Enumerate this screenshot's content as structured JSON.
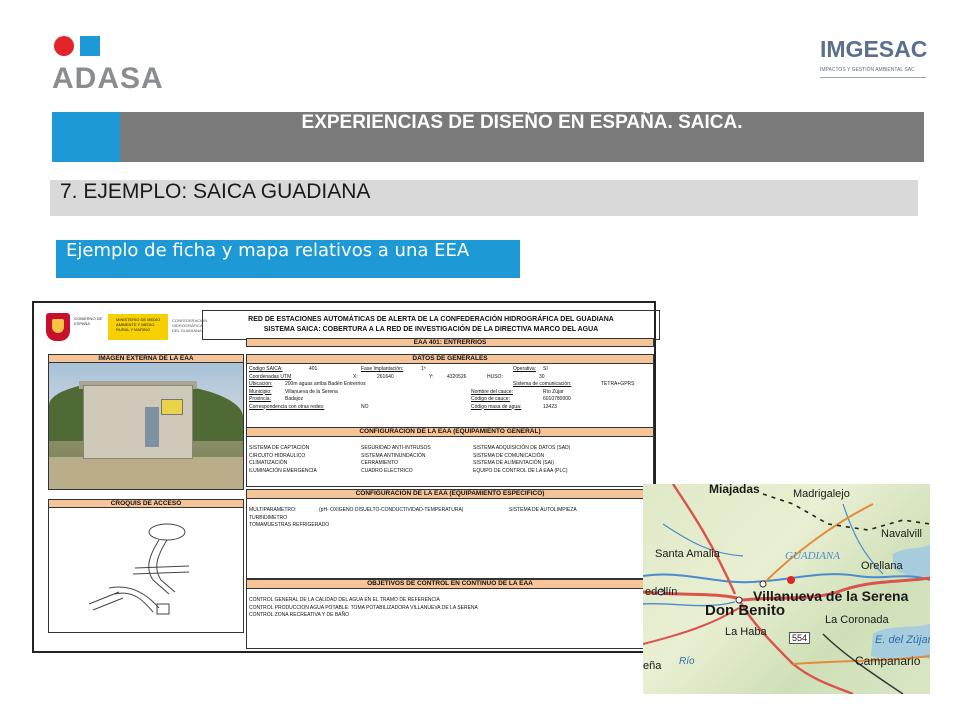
{
  "logos": {
    "left": "ADASA",
    "right": "IMGESAC",
    "right_tagline": "IMPACTOS Y GESTIÓN AMBIENTAL SAC",
    "brand_colors": {
      "red": "#e0242a",
      "blue": "#1d9ad6",
      "grey": "#8a8d8f"
    }
  },
  "header": {
    "title": "EXPERIENCIAS DE DISEÑO EN ESPAÑA. SAICA.",
    "section": "7. EJEMPLO: SAICA GUADIANA",
    "caption": "Ejemplo de ficha y mapa relativos a una EEA"
  },
  "sheet": {
    "gobierno": "GOBIERNO DE ESPAÑA",
    "ministerio": "MINISTERIO DE MEDIO AMBIENTE Y MEDIO RURAL Y MARINO",
    "confederacion": "CONFEDERACIÓN HIDROGRÁFICA DEL GUADIANA",
    "title_line1": "RED DE ESTACIONES AUTOMÁTICAS DE ALERTA DE LA CONFEDERACIÓN HIDROGRÁFICA DEL GUADIANA",
    "title_line2": "SISTEMA SAICA: COBERTURA A LA RED DE INVESTIGACIÓN DE LA DIRECTIVA MARCO DEL AGUA",
    "station": "EAA 401: ENTRERRIOS",
    "imagen_externa": "IMAGEN EXTERNA DE LA EAA",
    "croquis": "CROQUIS DE ACCESO",
    "datos": {
      "heading": "DATOS DE GENERALES",
      "codigo_label": "Codigo SAICA:",
      "codigo": "401",
      "fase_label": "Fase Implantación:",
      "fase": "1ª",
      "operativa_label": "Operativa:",
      "operativa": "SI",
      "utm_label": "Coordenadas UTM",
      "x_label": "X:",
      "x": "261640",
      "y_label": "Y:",
      "y": "4320526",
      "huso_label": "HUSO:",
      "huso": "30",
      "ubicacion_label": "Ubicación:",
      "ubicacion": "200m aguas arriba Badén Entrerrios",
      "comunicacion_label": "Sistema de comunicación:",
      "comunicacion": "TETRA+GPRS",
      "municipio_label": "Municipio:",
      "municipio": "Villanueva de la Serena",
      "cauce_label": "Nombre del cauce:",
      "cauce": "Río Zújar",
      "provincia_label": "Provincia:",
      "provincia": "Badajoz",
      "codcauce_label": "Codigo de cauce:",
      "codcauce": "6010780000",
      "redes_label": "Correspondencia con otras redes:",
      "redes": "NO",
      "masa_label": "Código masa de agua:",
      "masa": "13423"
    },
    "config_general": {
      "heading": "CONFIGURACIÓN DE LA EAA (EQUIPAMIENTO GENERAL)",
      "col1": [
        "SISTEMA DE CAPTACIÓN",
        "CIRCUITO HIDRAULICO",
        "CLIMATIZACIÓN",
        "ILUMINACIÓN EMERGENCIA"
      ],
      "col2": [
        "SEGURIDAD ANTI-INTRUSOS",
        "SISTEMA ANTINUNDACIÓN",
        "CERRAMIENTO",
        "CUADRO ELECTRICO"
      ],
      "col3": [
        "SISTEMA ADQUISICIÓN DE DATOS (SAD)",
        "SISTEMA DE COMUNICACIÓN",
        "SISTEMA DE ALIMENTACIÓN (SAI)",
        "EQUIPO DE CONTROL DE LA EAA (PLC)"
      ]
    },
    "config_especifico": {
      "heading": "CONFIGURACIÓN DE LA EAA (EQUIPAMIENTO ESPECIFICO)",
      "multiparametro": "MULTIPARAMETRO:",
      "parametros": "(pH- OXIGENO DISUELTO-CONDUCTIVIDAD-TEMPERATURA)",
      "autolimpieza": "SISTEMA DE AUTOLIMPIEZA",
      "turbidimetro": "TURBIDIMETRO",
      "tomamuestras": "TOMAMUESTRAS REFRIGERADO"
    },
    "objetivos": {
      "heading": "OBJETIVOS DE CONTROL EN CONTINUO DE LA EAA",
      "items": [
        "CONTROL GENERAL DE LA CALIDAD DEL AGUA EN EL TRAMO DE REFERENCIA",
        "CONTROL PRODUCCION AGUA POTABLE: TOMA POTABILIZADORA VILLANUEVA DE LA SERENA",
        "CONTROL ZONA RECREATIVA Y DE BAÑO"
      ]
    }
  },
  "map": {
    "labels": {
      "miajadas": "Miajadas",
      "madrigalejo": "Madrigalejo",
      "navalvillar": "Navalvill",
      "santa_amalia": "Santa Amalia",
      "guadiana": "GUADIANA",
      "orellana": "Orellana",
      "medellin": "edellín",
      "don_benito": "Don Benito",
      "villanueva": "Villanueva de la Serena",
      "la_haba": "La Haba",
      "la_coronada": "La Coronada",
      "road": "554",
      "zujar": "E. del Zújar",
      "campanario": "Campanario",
      "pena": "eña",
      "rio": "Río"
    }
  }
}
